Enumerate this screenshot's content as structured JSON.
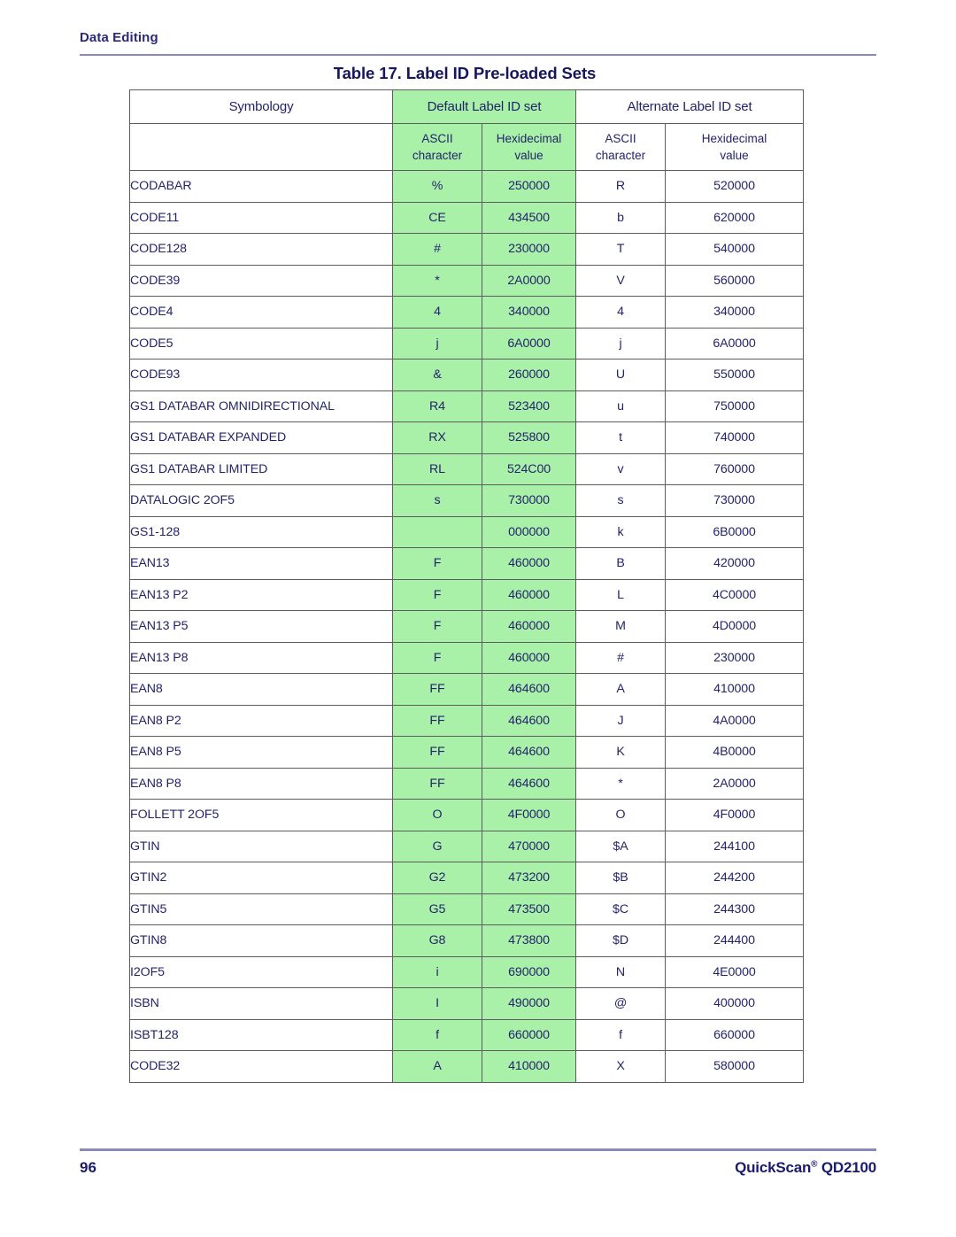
{
  "running_header": "Data Editing",
  "table_title": "Table 17. Label ID Pre-loaded Sets",
  "table": {
    "group_headers": {
      "symbology": "Symbology",
      "default_set": "Default Label ID set",
      "alternate_set": "Alternate Label ID set"
    },
    "sub_headers": {
      "ascii_line1": "ASCII",
      "ascii_line2": "character",
      "hex_line1": "Hexidecimal",
      "hex_line2": "value"
    },
    "rows": [
      {
        "symbology": "CODABAR",
        "default_ascii": "%",
        "default_hex": "250000",
        "alt_ascii": "R",
        "alt_hex": "520000"
      },
      {
        "symbology": "CODE11",
        "default_ascii": "CE",
        "default_hex": "434500",
        "alt_ascii": "b",
        "alt_hex": "620000"
      },
      {
        "symbology": "CODE128",
        "default_ascii": "#",
        "default_hex": "230000",
        "alt_ascii": "T",
        "alt_hex": "540000"
      },
      {
        "symbology": "CODE39",
        "default_ascii": "*",
        "default_hex": "2A0000",
        "alt_ascii": "V",
        "alt_hex": "560000"
      },
      {
        "symbology": "CODE4",
        "default_ascii": "4",
        "default_hex": "340000",
        "alt_ascii": "4",
        "alt_hex": "340000"
      },
      {
        "symbology": "CODE5",
        "default_ascii": "j",
        "default_hex": "6A0000",
        "alt_ascii": "j",
        "alt_hex": "6A0000"
      },
      {
        "symbology": "CODE93",
        "default_ascii": "&",
        "default_hex": "260000",
        "alt_ascii": "U",
        "alt_hex": "550000"
      },
      {
        "symbology": "GS1 DATABAR OMNIDIRECTIONAL",
        "default_ascii": "R4",
        "default_hex": "523400",
        "alt_ascii": "u",
        "alt_hex": "750000"
      },
      {
        "symbology": "GS1 DATABAR EXPANDED",
        "default_ascii": "RX",
        "default_hex": "525800",
        "alt_ascii": "t",
        "alt_hex": "740000"
      },
      {
        "symbology": "GS1 DATABAR LIMITED",
        "default_ascii": "RL",
        "default_hex": "524C00",
        "alt_ascii": "v",
        "alt_hex": "760000"
      },
      {
        "symbology": "DATALOGIC 2OF5",
        "default_ascii": "s",
        "default_hex": "730000",
        "alt_ascii": "s",
        "alt_hex": "730000"
      },
      {
        "symbology": "GS1-128",
        "default_ascii": "",
        "default_hex": "000000",
        "alt_ascii": "k",
        "alt_hex": "6B0000"
      },
      {
        "symbology": "EAN13",
        "default_ascii": "F",
        "default_hex": "460000",
        "alt_ascii": "B",
        "alt_hex": "420000"
      },
      {
        "symbology": "EAN13 P2",
        "default_ascii": "F",
        "default_hex": "460000",
        "alt_ascii": "L",
        "alt_hex": "4C0000"
      },
      {
        "symbology": "EAN13 P5",
        "default_ascii": "F",
        "default_hex": "460000",
        "alt_ascii": "M",
        "alt_hex": "4D0000"
      },
      {
        "symbology": "EAN13 P8",
        "default_ascii": "F",
        "default_hex": "460000",
        "alt_ascii": "#",
        "alt_hex": "230000"
      },
      {
        "symbology": "EAN8",
        "default_ascii": "FF",
        "default_hex": "464600",
        "alt_ascii": "A",
        "alt_hex": "410000"
      },
      {
        "symbology": "EAN8 P2",
        "default_ascii": "FF",
        "default_hex": "464600",
        "alt_ascii": "J",
        "alt_hex": "4A0000"
      },
      {
        "symbology": "EAN8 P5",
        "default_ascii": "FF",
        "default_hex": "464600",
        "alt_ascii": "K",
        "alt_hex": "4B0000"
      },
      {
        "symbology": "EAN8 P8",
        "default_ascii": "FF",
        "default_hex": "464600",
        "alt_ascii": "*",
        "alt_hex": "2A0000"
      },
      {
        "symbology": "FOLLETT 2OF5",
        "default_ascii": "O",
        "default_hex": "4F0000",
        "alt_ascii": "O",
        "alt_hex": "4F0000"
      },
      {
        "symbology": "GTIN",
        "default_ascii": "G",
        "default_hex": "470000",
        "alt_ascii": "$A",
        "alt_hex": "244100"
      },
      {
        "symbology": "GTIN2",
        "default_ascii": "G2",
        "default_hex": "473200",
        "alt_ascii": "$B",
        "alt_hex": "244200"
      },
      {
        "symbology": "GTIN5",
        "default_ascii": "G5",
        "default_hex": "473500",
        "alt_ascii": "$C",
        "alt_hex": "244300"
      },
      {
        "symbology": "GTIN8",
        "default_ascii": "G8",
        "default_hex": "473800",
        "alt_ascii": "$D",
        "alt_hex": "244400"
      },
      {
        "symbology": "I2OF5",
        "default_ascii": "i",
        "default_hex": "690000",
        "alt_ascii": "N",
        "alt_hex": "4E0000"
      },
      {
        "symbology": "ISBN",
        "default_ascii": "I",
        "default_hex": "490000",
        "alt_ascii": "@",
        "alt_hex": "400000"
      },
      {
        "symbology": "ISBT128",
        "default_ascii": "f",
        "default_hex": "660000",
        "alt_ascii": "f",
        "alt_hex": "660000"
      },
      {
        "symbology": "CODE32",
        "default_ascii": "A",
        "default_hex": "410000",
        "alt_ascii": "X",
        "alt_hex": "580000"
      }
    ]
  },
  "footer": {
    "page_number": "96",
    "product_name": "QuickScan",
    "product_mark": "®",
    "product_model": "QD2100"
  },
  "colors": {
    "highlight_green": "#a9f0a9",
    "text_navy": "#23236b",
    "title_navy": "#16165e",
    "rule_purple": "#8a8ab8",
    "border_gray": "#5d5d5d"
  }
}
